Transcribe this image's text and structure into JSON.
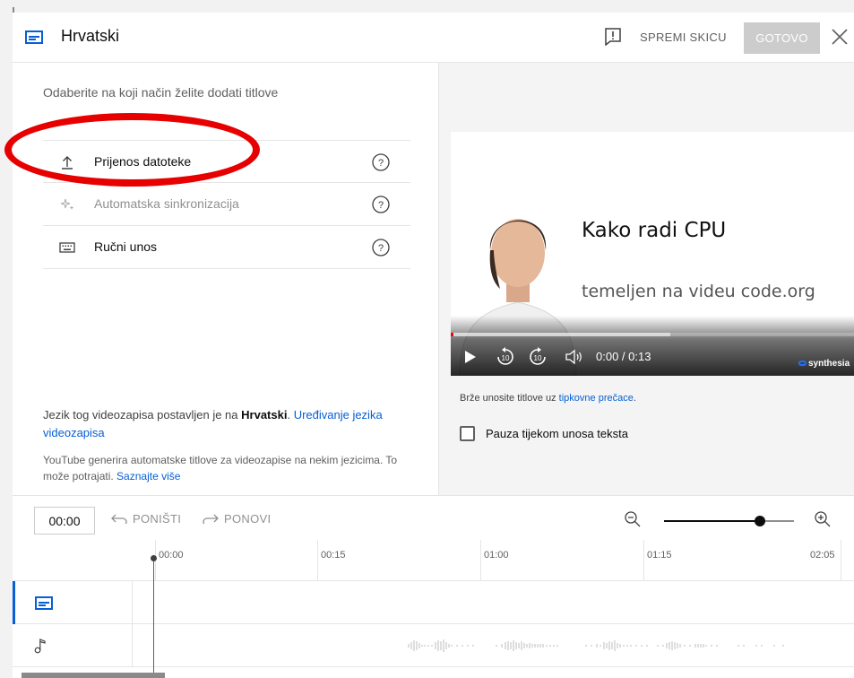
{
  "header": {
    "title": "Hrvatski",
    "save_draft_label": "SPREMI SKICU",
    "done_label": "GOTOVO"
  },
  "left": {
    "prompt": "Odaberite na koji način želite dodati titlove",
    "options": [
      {
        "label": "Prijenos datoteke",
        "icon": "upload-icon",
        "disabled": false
      },
      {
        "label": "Automatska sinkronizacija",
        "icon": "sparkle-icon",
        "disabled": true
      },
      {
        "label": "Ručni unos",
        "icon": "keyboard-icon",
        "disabled": false
      }
    ],
    "lang_note_prefix": "Jezik tog videozapisa postavljen je na ",
    "lang_note_lang": "Hrvatski",
    "lang_note_dot": ". ",
    "lang_note_link": "Uređivanje jezika videozapisa",
    "auto_note": "YouTube generira automatske titlove za videozapise na nekim jezicima. To može potrajati. ",
    "auto_note_link": "Saznajte više"
  },
  "right": {
    "video_title": "Kako radi CPU",
    "video_subtitle": "temeljen na videu code.org",
    "time_display": "0:00 / 0:13",
    "brand": "synthesia",
    "shortcut_prefix": "Brže unosite titlove uz ",
    "shortcut_link": "tipkovne prečace",
    "shortcut_suffix": ".",
    "pause_label": "Pauza tijekom unosa teksta",
    "pause_checked": false
  },
  "toolbar": {
    "time_value": "00:00",
    "undo_label": "PONIŠTI",
    "redo_label": "PONOVI"
  },
  "timeline": {
    "ticks": [
      "00:00",
      "00:15",
      "01:00",
      "01:15",
      "02:05"
    ]
  },
  "colors": {
    "accent": "#065fd4",
    "annotation": "#e60000",
    "progress": "#ff0000"
  }
}
